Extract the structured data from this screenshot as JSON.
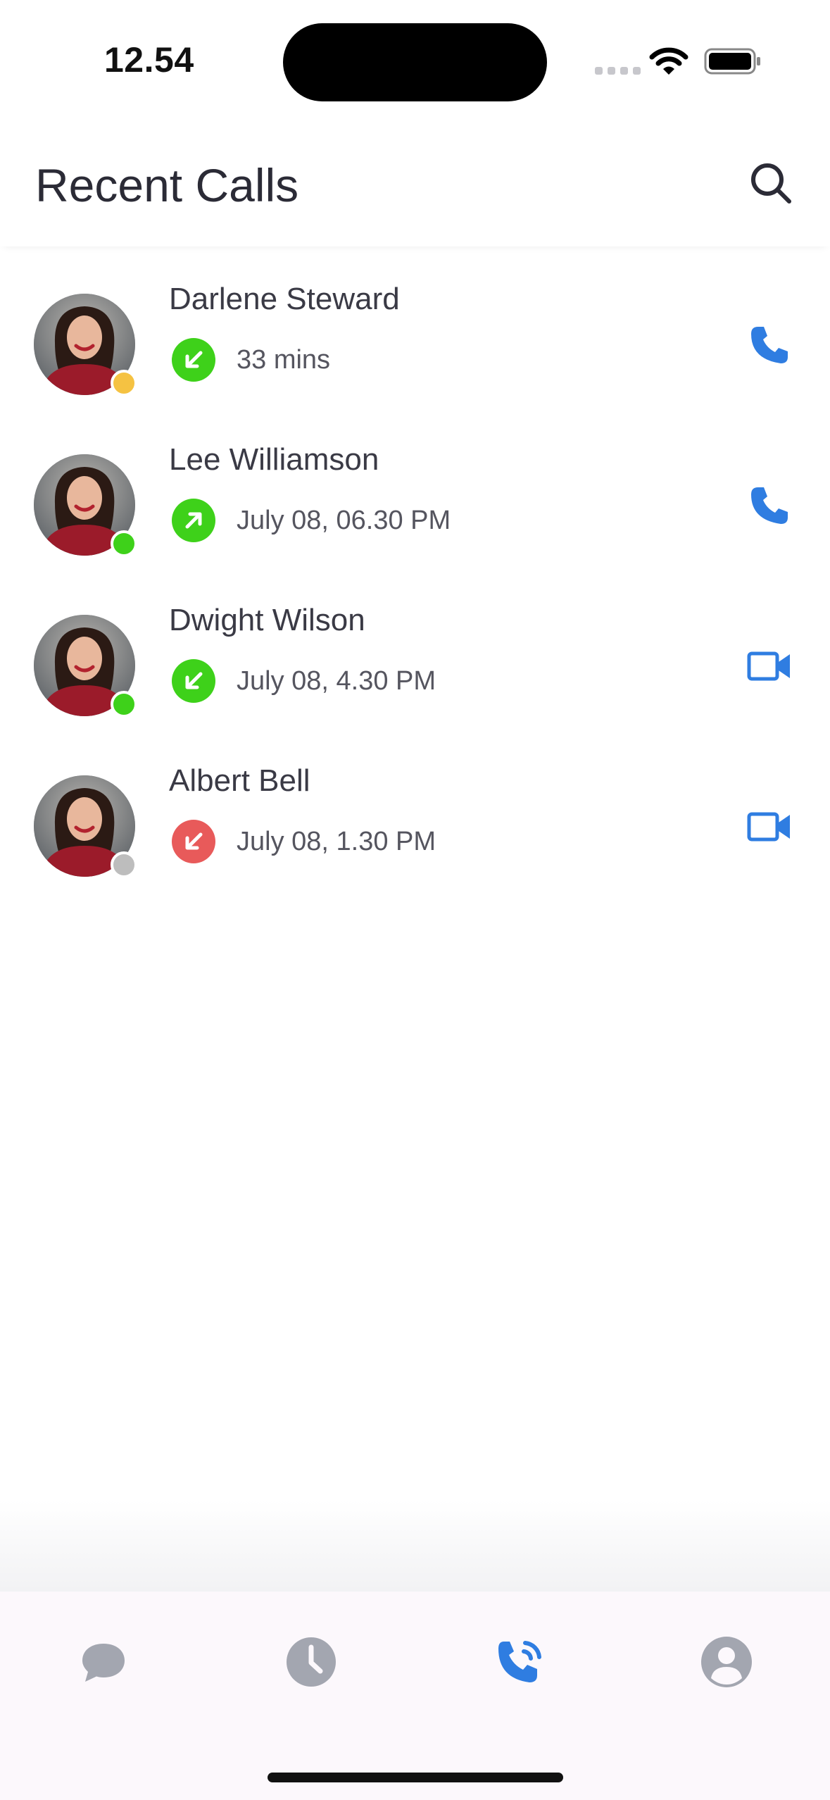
{
  "status_bar": {
    "time": "12.54"
  },
  "header": {
    "title": "Recent Calls",
    "search_icon": "search-icon"
  },
  "calls": [
    {
      "name": "Darlene Steward",
      "detail": "33 mins",
      "direction": "incoming",
      "direction_color": "#3ed11a",
      "presence_color": "#f5c242",
      "action": "phone"
    },
    {
      "name": "Lee Williamson",
      "detail": "July 08, 06.30 PM",
      "direction": "outgoing",
      "direction_color": "#3ed11a",
      "presence_color": "#3ed11a",
      "action": "phone"
    },
    {
      "name": "Dwight Wilson",
      "detail": "July 08, 4.30 PM",
      "direction": "incoming",
      "direction_color": "#3ed11a",
      "presence_color": "#3ed11a",
      "action": "video"
    },
    {
      "name": "Albert Bell",
      "detail": "July 08, 1.30 PM",
      "direction": "missed",
      "direction_color": "#e85a5a",
      "presence_color": "#bdbdbd",
      "action": "video"
    }
  ],
  "tab_bar": {
    "tabs": [
      {
        "icon": "chat-icon",
        "active": false
      },
      {
        "icon": "clock-icon",
        "active": false
      },
      {
        "icon": "calls-icon",
        "active": true
      },
      {
        "icon": "profile-icon",
        "active": false
      }
    ]
  },
  "colors": {
    "accent": "#2f7de1",
    "inactive_icon": "#a3a6b0"
  }
}
